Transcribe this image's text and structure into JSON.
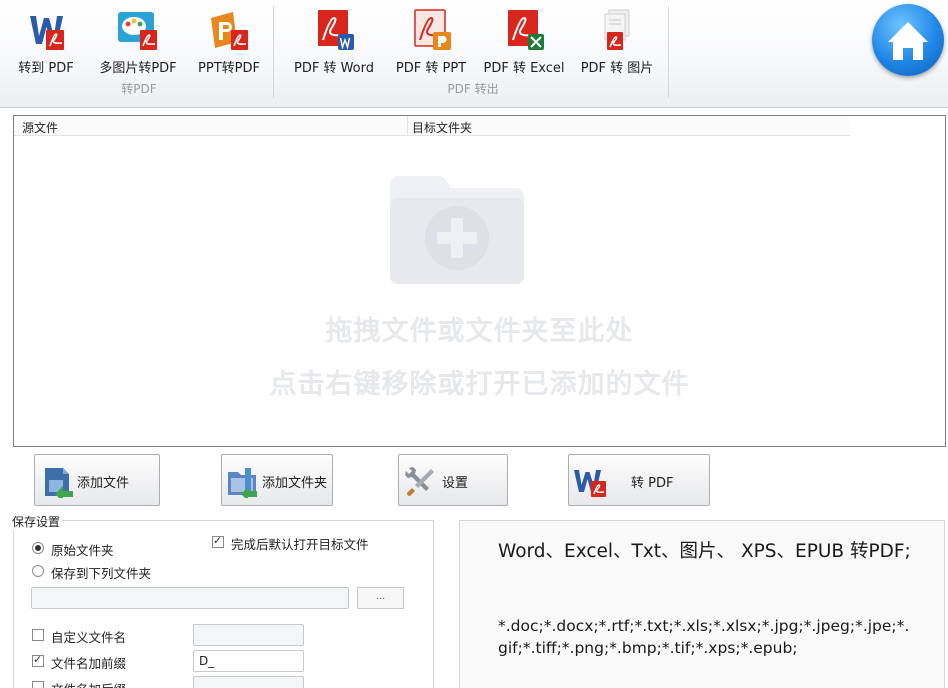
{
  "ribbon": {
    "groups": [
      {
        "label": "转PDF",
        "buttons": [
          {
            "label": "转到 PDF",
            "icon": "word-to-pdf-icon"
          },
          {
            "label": "多图片转PDF",
            "icon": "images-to-pdf-icon"
          },
          {
            "label": "PPT转PDF",
            "icon": "ppt-to-pdf-icon"
          }
        ]
      },
      {
        "label": "PDF 转出",
        "buttons": [
          {
            "label": "PDF 转 Word",
            "icon": "pdf-to-word-icon"
          },
          {
            "label": "PDF 转 PPT",
            "icon": "pdf-to-ppt-icon"
          },
          {
            "label": "PDF 转 Excel",
            "icon": "pdf-to-excel-icon"
          },
          {
            "label": "PDF 转 图片",
            "icon": "pdf-to-image-icon"
          }
        ]
      }
    ],
    "home_icon": "home-icon"
  },
  "file_list": {
    "columns": [
      "源文件",
      "目标文件夹"
    ],
    "drop_hint_line1": "拖拽文件或文件夹至此处",
    "drop_hint_line2": "点击右键移除或打开已添加的文件",
    "drop_icon": "folder-add-icon"
  },
  "actions": {
    "add_file": "添加文件",
    "add_folder": "添加文件夹",
    "settings": "设置",
    "convert": "转 PDF"
  },
  "save_settings": {
    "title": "保存设置",
    "original_folder": "原始文件夹",
    "save_to_folder": "保存到下列文件夹",
    "open_after": "完成后默认打开目标文件",
    "browse": "...",
    "custom_name": "自定义文件名",
    "add_prefix": "文件名加前缀",
    "prefix_value": "D_",
    "add_suffix": "文件名加后缀"
  },
  "info": {
    "headline": "Word、Excel、Txt、图片、 XPS、EPUB 转PDF;",
    "extensions": "*.doc;*.docx;*.rtf;*.txt;*.xls;*.xlsx;*.jpg;*.jpeg;*.jpe;*.gif;*.tiff;*.png;*.bmp;*.tif;*.xps;*.epub;"
  },
  "colors": {
    "pdf_red": "#d8261c",
    "word_blue": "#2a5aa8",
    "home_blue": "#1f86e6",
    "ppt_orange": "#e8871b"
  }
}
